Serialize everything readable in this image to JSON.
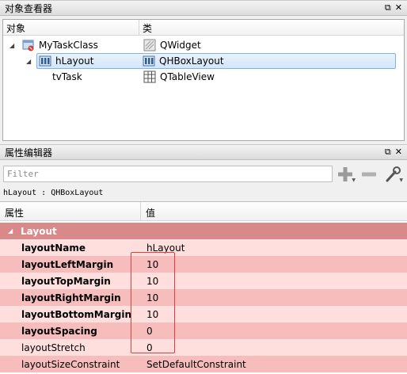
{
  "object_inspector": {
    "title": "对象查看器",
    "col_object": "对象",
    "col_class": "类",
    "rows": [
      {
        "name": "MyTaskClass",
        "cls": "QWidget"
      },
      {
        "name": "hLayout",
        "cls": "QHBoxLayout"
      },
      {
        "name": "tvTask",
        "cls": "QTableView"
      }
    ]
  },
  "property_editor": {
    "title": "属性编辑器",
    "filter_placeholder": "Filter",
    "object_label": "hLayout : QHBoxLayout",
    "col_property": "属性",
    "col_value": "值",
    "group": "Layout",
    "rows": [
      {
        "name": "layoutName",
        "value": "hLayout",
        "bold": true
      },
      {
        "name": "layoutLeftMargin",
        "value": "10",
        "bold": true
      },
      {
        "name": "layoutTopMargin",
        "value": "10",
        "bold": true
      },
      {
        "name": "layoutRightMargin",
        "value": "10",
        "bold": true
      },
      {
        "name": "layoutBottomMargin",
        "value": "10",
        "bold": true
      },
      {
        "name": "layoutSpacing",
        "value": "0",
        "bold": true
      },
      {
        "name": "layoutStretch",
        "value": "0",
        "bold": false
      },
      {
        "name": "layoutSizeConstraint",
        "value": "SetDefaultConstraint",
        "bold": false
      }
    ]
  },
  "colors": {
    "group_header": "#d98989",
    "row_light": "#ffdede",
    "row_dark": "#f7bdbd",
    "selection": "#d3e6fa",
    "annotation": "#e04040"
  }
}
